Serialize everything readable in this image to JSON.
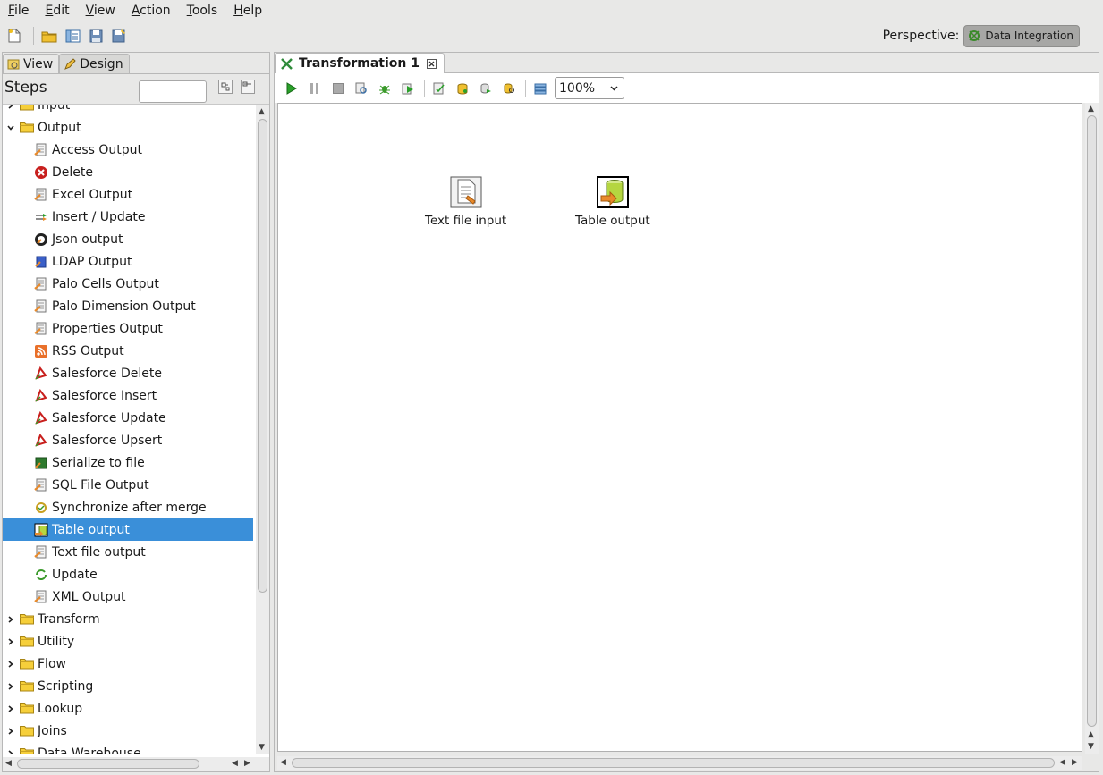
{
  "menu": [
    "File",
    "Edit",
    "View",
    "Action",
    "Tools",
    "Help"
  ],
  "main_toolbar": {
    "buttons": [
      "new-file-icon",
      "open-folder-icon",
      "explore-repository-icon",
      "save-icon",
      "save-as-icon"
    ]
  },
  "perspective": {
    "label": "Perspective:",
    "value": "Data Integration"
  },
  "left_tabs": [
    {
      "label": "View",
      "active": false
    },
    {
      "label": "Design",
      "active": true
    }
  ],
  "steps_panel": {
    "title": "Steps",
    "search_value": ""
  },
  "tree": [
    {
      "type": "category",
      "label": "Input",
      "expanded": false
    },
    {
      "type": "category",
      "label": "Output",
      "expanded": true
    },
    {
      "type": "step",
      "label": "Access Output",
      "icon": "access-output-icon"
    },
    {
      "type": "step",
      "label": "Delete",
      "icon": "delete-icon"
    },
    {
      "type": "step",
      "label": "Excel Output",
      "icon": "excel-output-icon"
    },
    {
      "type": "step",
      "label": "Insert / Update",
      "icon": "insert-update-icon"
    },
    {
      "type": "step",
      "label": "Json output",
      "icon": "json-output-icon"
    },
    {
      "type": "step",
      "label": "LDAP Output",
      "icon": "ldap-output-icon"
    },
    {
      "type": "step",
      "label": "Palo Cells Output",
      "icon": "palo-cells-output-icon"
    },
    {
      "type": "step",
      "label": "Palo Dimension Output",
      "icon": "palo-dimension-output-icon"
    },
    {
      "type": "step",
      "label": "Properties Output",
      "icon": "properties-output-icon"
    },
    {
      "type": "step",
      "label": "RSS Output",
      "icon": "rss-output-icon"
    },
    {
      "type": "step",
      "label": "Salesforce Delete",
      "icon": "salesforce-delete-icon"
    },
    {
      "type": "step",
      "label": "Salesforce Insert",
      "icon": "salesforce-insert-icon"
    },
    {
      "type": "step",
      "label": "Salesforce Update",
      "icon": "salesforce-update-icon"
    },
    {
      "type": "step",
      "label": "Salesforce Upsert",
      "icon": "salesforce-upsert-icon"
    },
    {
      "type": "step",
      "label": "Serialize to file",
      "icon": "serialize-to-file-icon"
    },
    {
      "type": "step",
      "label": "SQL File Output",
      "icon": "sql-file-output-icon"
    },
    {
      "type": "step",
      "label": "Synchronize after merge",
      "icon": "synchronize-after-merge-icon"
    },
    {
      "type": "step",
      "label": "Table output",
      "icon": "table-output-icon",
      "selected": true
    },
    {
      "type": "step",
      "label": "Text file output",
      "icon": "text-file-output-icon"
    },
    {
      "type": "step",
      "label": "Update",
      "icon": "update-icon"
    },
    {
      "type": "step",
      "label": "XML Output",
      "icon": "xml-output-icon"
    },
    {
      "type": "category",
      "label": "Transform",
      "expanded": false
    },
    {
      "type": "category",
      "label": "Utility",
      "expanded": false
    },
    {
      "type": "category",
      "label": "Flow",
      "expanded": false
    },
    {
      "type": "category",
      "label": "Scripting",
      "expanded": false
    },
    {
      "type": "category",
      "label": "Lookup",
      "expanded": false
    },
    {
      "type": "category",
      "label": "Joins",
      "expanded": false
    },
    {
      "type": "category",
      "label": "Data Warehouse",
      "expanded": false
    }
  ],
  "editor": {
    "tab_label": "Transformation 1",
    "toolbar_buttons": [
      "run-icon",
      "pause-icon",
      "stop-icon",
      "preview-icon",
      "debug-icon",
      "replay-icon",
      "verify-icon",
      "impact-icon",
      "sql-icon",
      "explore-db-icon",
      "show-results-icon"
    ],
    "zoom": "100%",
    "zoom_options": [
      "100%"
    ]
  },
  "canvas": {
    "steps": [
      {
        "label": "Text file input",
        "icon": "text-file-input-icon"
      },
      {
        "label": "Table output",
        "icon": "table-output-icon"
      }
    ]
  },
  "colors": {
    "selection": "#3a8fd9",
    "window_bg": "#e8e8e7",
    "run_green": "#2aa02a"
  }
}
